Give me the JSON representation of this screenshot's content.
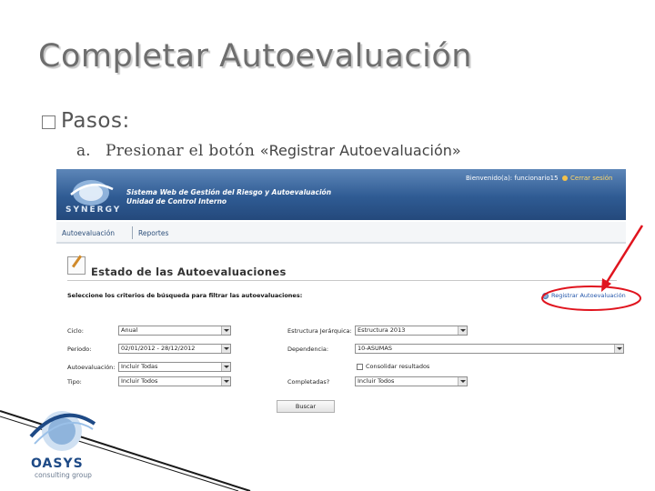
{
  "slide": {
    "title": "Completar Autoevaluación",
    "bullet": "Pasos:",
    "step_letter": "a.",
    "step_text": "Presionar el botón ",
    "step_quote": "«Registrar Autoevaluación»"
  },
  "app": {
    "logo_word": "SYNERGY",
    "system_title": "Sistema Web de Gestión del Riesgo y Autoevaluación",
    "system_subtitle": "Unidad de Control Interno",
    "welcome": "Bienvenido(a): funcionario15",
    "logout": "Cerrar sesión",
    "menu": [
      "Autoevaluación",
      "Reportes"
    ],
    "page_title": "Estado de las Autoevaluaciones",
    "instructions": "Seleccione los criterios de búsqueda para filtrar las autoevaluaciones:",
    "register_link": "Registrar Autoevaluación",
    "filters": {
      "ciclo_label": "Ciclo:",
      "ciclo_value": "Anual",
      "periodo_label": "Periodo:",
      "periodo_value": "02/01/2012 - 28/12/2012",
      "autoevaluacion_label": "Autoevaluación:",
      "autoevaluacion_value": "Incluir Todas",
      "tipo_label": "Tipo:",
      "tipo_value": "Incluir Todos",
      "estructura_label": "Estructura Jerárquica:",
      "estructura_value": "Estructura 2013",
      "dependencia_label": "Dependencia:",
      "dependencia_value": "10-ASUMAS",
      "checkbox_label": "Consolidar resultados",
      "completadas_label": "Completadas?",
      "completadas_value": "Incluir Todos"
    },
    "search_button": "Buscar"
  },
  "footer_logo": {
    "name": "OASYS",
    "tagline": "consulting group"
  },
  "colors": {
    "banner": "#2f5b93",
    "annotation": "#e0141e",
    "title_gray": "#6e6e6e"
  }
}
